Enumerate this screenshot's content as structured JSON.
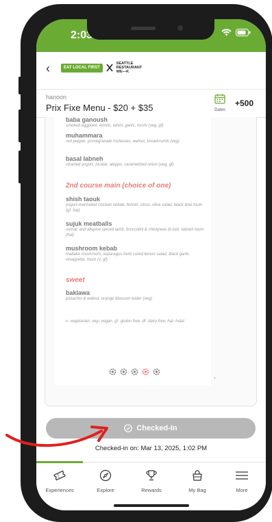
{
  "status": {
    "time": "2:03"
  },
  "nav": {
    "back_glyph": "‹",
    "logo_eat_local": "EAT LOCAL FIRST",
    "logo_srw": "SEATTLE RESTAURANT WE—K"
  },
  "header": {
    "restaurant": "hanoon",
    "menu_title": "Prix Fixe Menu - $20 + $35",
    "dates_label": "Dates",
    "points": "+500"
  },
  "menu": {
    "items_top": [
      {
        "name": "baba ganoush",
        "desc": "smoked eggplant, lemon, tahini, garlic, torshi (veg, gf)"
      },
      {
        "name": "muhammara",
        "desc": "red pepper, pomegranate molasses, walnut, breadcrumb (veg)"
      },
      {
        "name": "basal labneh",
        "desc": "strained yogurt, za'atar, aleppo, caramelized onion (veg, gf)"
      }
    ],
    "section_main": "2nd course main (choice of one)",
    "items_main": [
      {
        "name": "shish taouk",
        "desc": "yogurt-marinated chicken kebab, fennel, citrus, olive salad, black lime toum (gf, hal)"
      },
      {
        "name": "sujuk meatballs",
        "desc": "sumac and allspice spiced lamb, broccolini & chickpeas bi-zeit, labneh toum (hal)"
      },
      {
        "name": "mushroom kebab",
        "desc": "maitake mushroom, asparagus herb cured lemon salad, black garlic vinaigrette, toum (v, gf)"
      }
    ],
    "section_sweet": "sweet",
    "items_sweet": [
      {
        "name": "baklawa",
        "desc": "pistachio & walnut, orange blossom water (veg)"
      }
    ],
    "footnote": "v- vegetarian, veg- vegan, gf- gluten free, df- dairy free, hal- halal",
    "asterisk": "*"
  },
  "checkin": {
    "label": "Checked-In",
    "timestamp": "Checked-in on: Mar 13, 2025, 1:02 PM"
  },
  "tabs": [
    {
      "label": "Experiences",
      "icon": "ticket-icon"
    },
    {
      "label": "Explore",
      "icon": "compass-icon"
    },
    {
      "label": "Rewards",
      "icon": "trophy-icon"
    },
    {
      "label": "My Bag",
      "icon": "bag-icon"
    },
    {
      "label": "More",
      "icon": "menu-icon"
    }
  ],
  "colors": {
    "brand_green": "#6aab34",
    "section_red": "#e87b7b",
    "arrow_red": "#e02020",
    "button_gray": "#b8b8b8"
  }
}
